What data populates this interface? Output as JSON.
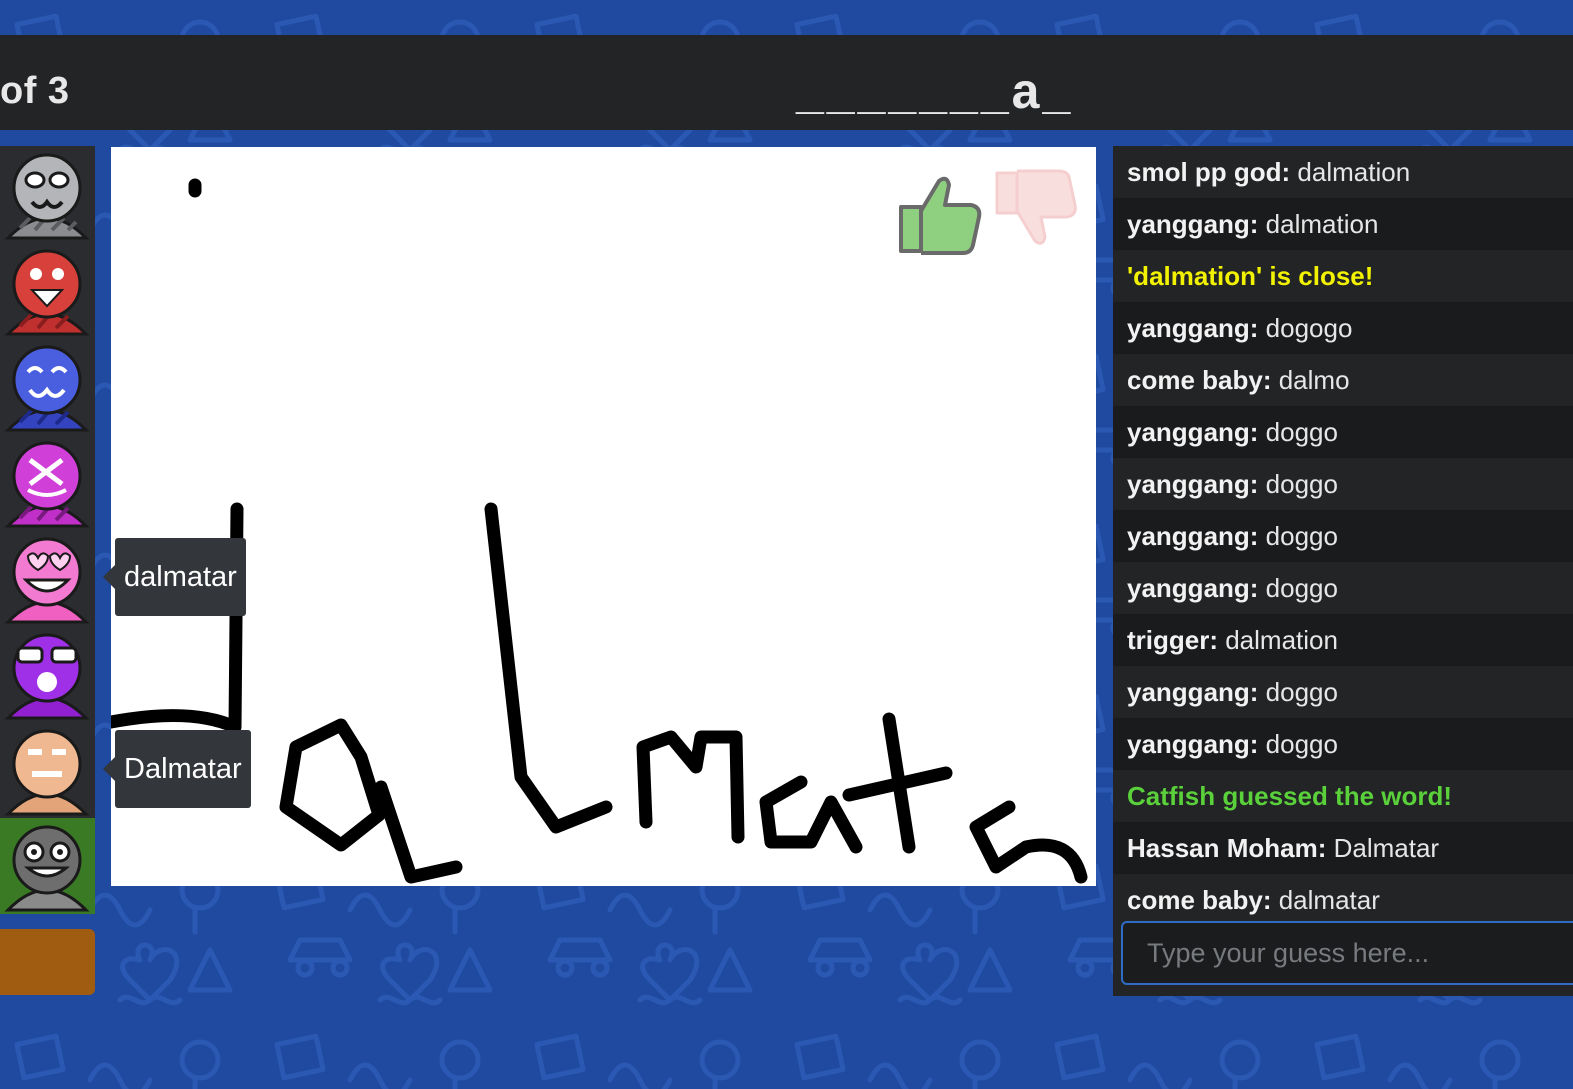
{
  "header": {
    "round_text": "of 3",
    "word_hint": "_______a_"
  },
  "players": [
    {
      "avatar": "grey-cat-avatar-icon"
    },
    {
      "avatar": "red-tongue-avatar-icon"
    },
    {
      "avatar": "blue-cat-avatar-icon"
    },
    {
      "avatar": "purple-dizzy-avatar-icon"
    },
    {
      "avatar": "pink-heart-eyes-avatar-icon"
    },
    {
      "avatar": "purple-sunglasses-avatar-icon"
    },
    {
      "avatar": "tan-avatar-icon"
    },
    {
      "avatar": "gray-grin-avatar-icon",
      "highlight_color": "#3a7a24"
    }
  ],
  "bubbles": {
    "player5": "dalmatar",
    "player7": "Dalmatar"
  },
  "canvas": {
    "drawn_text": "dalmatar",
    "rating": {
      "like": "thumbs-up-icon",
      "dislike": "thumbs-down-icon"
    }
  },
  "chat": {
    "messages": [
      {
        "author": "smol pp god:",
        "text": " dalmation"
      },
      {
        "author": "yanggang:",
        "text": " dalmation"
      },
      {
        "author": "",
        "text": "'dalmation' is close!",
        "kind": "close"
      },
      {
        "author": "yanggang:",
        "text": " dogogo"
      },
      {
        "author": "come baby:",
        "text": " dalmo"
      },
      {
        "author": "yanggang:",
        "text": " doggo"
      },
      {
        "author": "yanggang:",
        "text": " doggo"
      },
      {
        "author": "yanggang:",
        "text": " doggo"
      },
      {
        "author": "yanggang:",
        "text": " doggo"
      },
      {
        "author": "trigger:",
        "text": " dalmation"
      },
      {
        "author": "yanggang:",
        "text": " doggo"
      },
      {
        "author": "yanggang:",
        "text": " doggo"
      },
      {
        "author": "",
        "text": "Catfish guessed the word!",
        "kind": "correct"
      },
      {
        "author": "Hassan Moham:",
        "text": " Dalmatar"
      },
      {
        "author": "come baby:",
        "text": " dalmatar"
      }
    ],
    "input_placeholder": "Type your guess here..."
  },
  "colors": {
    "background": "#1f4aa0",
    "bar": "#222426",
    "close": "#f2f200",
    "correct": "#5ad03a"
  }
}
